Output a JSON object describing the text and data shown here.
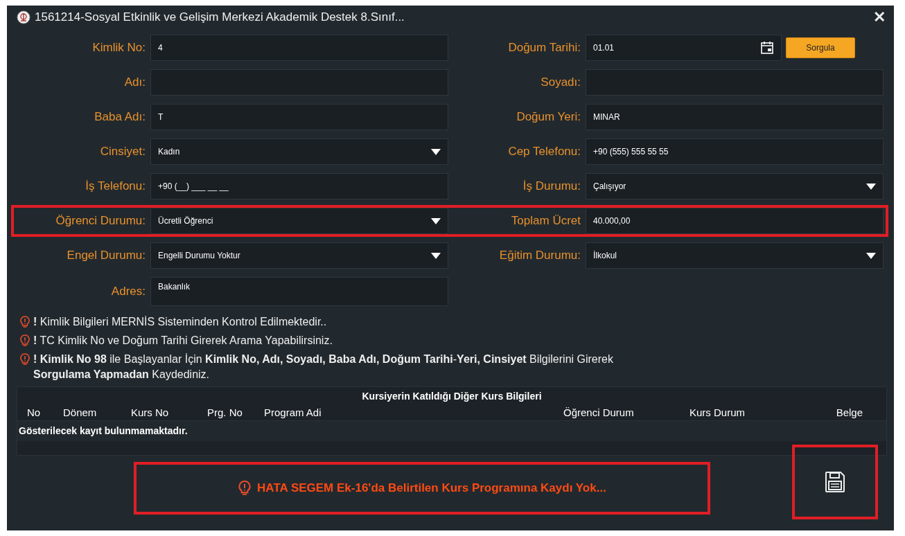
{
  "window": {
    "title": "1561214-Sosyal Etkinlik ve Gelişim Merkezi Akademik Destek 8.Sınıf...",
    "close": "✕"
  },
  "rows": [
    {
      "highlighted": false,
      "left": {
        "label": "Kimlik No:",
        "kind": "text",
        "value": "4"
      },
      "right": {
        "label": "Doğum Tarihi:",
        "kind": "date",
        "value": "01.01",
        "button": "Sorgula"
      }
    },
    {
      "highlighted": false,
      "left": {
        "label": "Adı:",
        "kind": "text"
      },
      "right": {
        "label": "Soyadı:",
        "kind": "text"
      }
    },
    {
      "highlighted": false,
      "left": {
        "label": "Baba Adı:",
        "kind": "text",
        "value": "T"
      },
      "right": {
        "label": "Doğum Yeri:",
        "kind": "text",
        "value": "MINAR"
      }
    },
    {
      "highlighted": false,
      "left": {
        "label": "Cinsiyet:",
        "kind": "select",
        "value": "Kadın"
      },
      "right": {
        "label": "Cep Telefonu:",
        "kind": "text",
        "value": "+90 (555) 555 55 55"
      }
    },
    {
      "highlighted": false,
      "left": {
        "label": "İş Telefonu:",
        "kind": "text",
        "value": "+90 (__) ___ __ __"
      },
      "right": {
        "label": "İş Durumu:",
        "kind": "select",
        "value": "Çalışıyor"
      }
    },
    {
      "highlighted": true,
      "left": {
        "label": "Öğrenci Durumu:",
        "kind": "select",
        "value": "Ücretli Öğrenci"
      },
      "right": {
        "label": "Toplam Ücret",
        "kind": "text",
        "value": "40.000,00"
      }
    },
    {
      "highlighted": false,
      "left": {
        "label": "Engel Durumu:",
        "kind": "select",
        "value": "Engelli Durumu Yoktur"
      },
      "right": {
        "label": "Eğitim Durumu:",
        "kind": "select",
        "value": "İlkokul"
      }
    },
    {
      "highlighted": false,
      "left": {
        "label": "Adres:",
        "kind": "area",
        "value": "Bakanlık"
      }
    }
  ],
  "notes": [
    "**!** Kimlik Bilgileri MERNİS Sisteminden Kontrol Edilmektedir..",
    "**!** TC Kimlik No ve Doğum Tarihi Girerek Arama Yapabilirsiniz.",
    "**! Kimlik No 98** ile Başlayanlar İçin **Kimlik No, Adı, Soyadı, Baba Adı, Doğum Tarihi**-**Yeri, Cinsiyet** Bilgilerini Girerek **Sorgulama Yapmadan** Kaydediniz."
  ],
  "table": {
    "title": "Kursiyerin Katıldığı Diğer Kurs Bilgileri",
    "columns": [
      "No",
      "Dönem",
      "Kurs No",
      "Prg. No",
      "Program Adi",
      "Öğrenci Durum",
      "Kurs Durum",
      "Belge"
    ],
    "empty_message": "Gösterilecek kayıt bulunmamaktadır."
  },
  "error": {
    "text": "HATA SEGEM Ek-16'da Belirtilen Kurs Programına Kaydı Yok...",
    "highlighted": true
  },
  "save_button": {
    "highlighted": true
  }
}
